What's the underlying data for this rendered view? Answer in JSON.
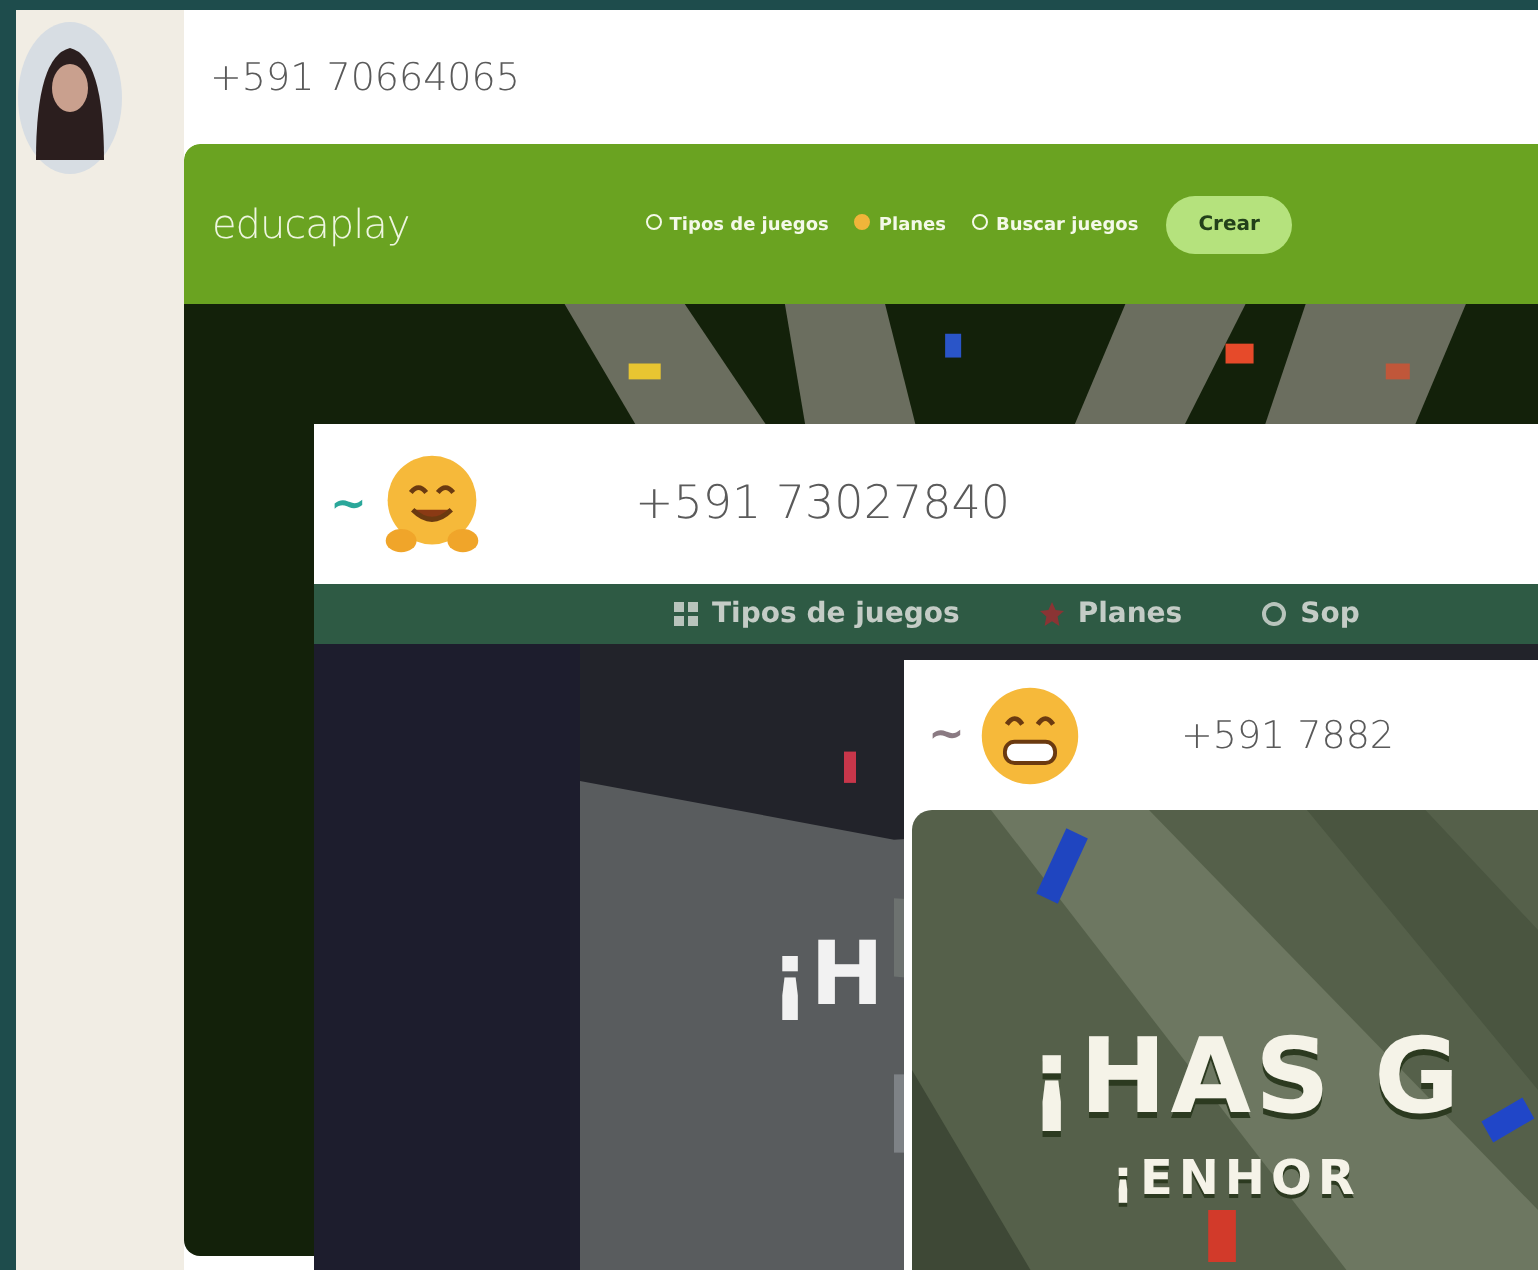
{
  "posts": [
    {
      "kind": "avatar",
      "phone": "+591 70664065",
      "screenshot": {
        "kind": "site_header",
        "logo": "educaplay",
        "nav": [
          {
            "label": "Tipos de juegos"
          },
          {
            "label": "Planes"
          },
          {
            "label": "Buscar juegos"
          }
        ],
        "button": "Crear"
      }
    },
    {
      "kind": "emoji",
      "prefix": "~",
      "phone": "+591 73027840",
      "screenshot": {
        "kind": "site_nav",
        "nav": [
          {
            "label": "Tipos de juegos"
          },
          {
            "label": "Planes"
          },
          {
            "label": "Sop"
          }
        ],
        "headline": "¡H"
      }
    },
    {
      "kind": "emoji",
      "prefix": "~",
      "phone": "+591 7882",
      "screenshot": {
        "kind": "win",
        "headline": "¡HAS G",
        "subline": "¡ENHOR"
      }
    }
  ]
}
